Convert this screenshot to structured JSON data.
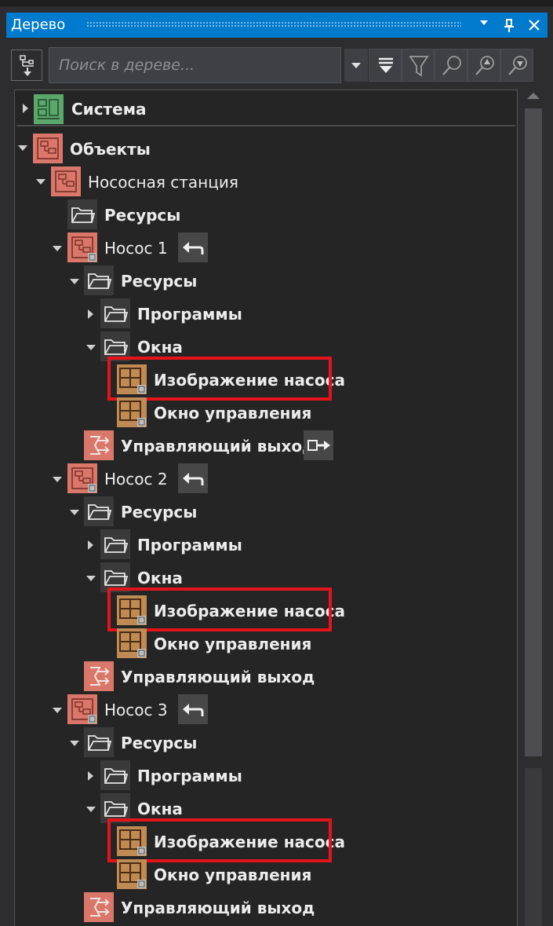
{
  "panel": {
    "title": "Дерево",
    "accent": "#007acc"
  },
  "toolbar": {
    "search_placeholder": "Поиск в дереве..."
  },
  "tree": {
    "system": "Система",
    "objects": "Объекты",
    "station": "Нососная станция",
    "resources": "Ресурсы",
    "pump1": "Нococ 1",
    "pump2": "Нococ 2",
    "pump3": "Нococ 3",
    "programs": "Программы",
    "windows": "Окна",
    "pump_image": "Изображение насоса",
    "control_window": "Окно управления",
    "control_output": "Управляющий выход"
  },
  "colors": {
    "highlight": "#e3141b",
    "object_icon": "#d9776a",
    "window_icon": "#c08a55",
    "system_icon": "#5aa86c"
  },
  "icons": [
    "tree-structure-icon",
    "filter-icon",
    "search-icon",
    "find-previous-icon",
    "find-next-icon",
    "collapse-all-icon",
    "pin-icon",
    "close-icon",
    "folder-icon",
    "object-icon",
    "window-icon",
    "system-icon",
    "output-icon",
    "undo-arrow-icon",
    "output-arrow-icon"
  ]
}
